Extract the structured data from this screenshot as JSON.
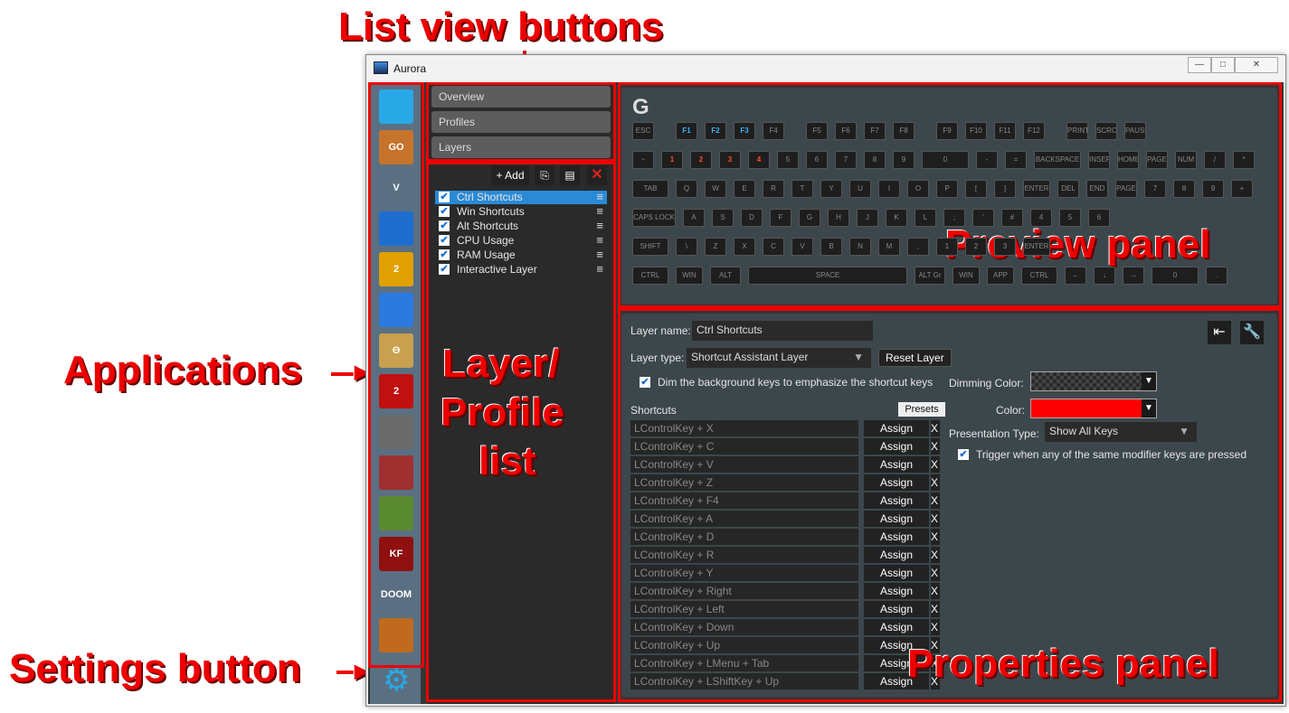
{
  "annotations": {
    "list_view_buttons": "List view buttons",
    "applications": "Applications",
    "layer_profile_list_1": "Layer/",
    "layer_profile_list_2": "Profile",
    "layer_profile_list_3": "list",
    "preview_panel": "Preview panel",
    "settings_button": "Settings button",
    "properties_panel": "Properties panel"
  },
  "window": {
    "title": "Aurora",
    "minimize": "—",
    "maximize": "□",
    "close": "✕"
  },
  "apps": [
    {
      "name": "desktop",
      "label": "",
      "color": "#29a8e6"
    },
    {
      "name": "csgo",
      "label": "GO",
      "color": "#c6742c"
    },
    {
      "name": "gta-v",
      "label": "V",
      "color": "#5a7082"
    },
    {
      "name": "rocket-league",
      "label": "",
      "color": "#1e6ed0"
    },
    {
      "name": "payday-2",
      "label": "2",
      "color": "#e0a000"
    },
    {
      "name": "dota-2",
      "label": "",
      "color": "#2a7ae0"
    },
    {
      "name": "overwatch-style",
      "label": "Θ",
      "color": "#c8a050"
    },
    {
      "name": "guild-wars-2",
      "label": "2",
      "color": "#c01010"
    },
    {
      "name": "euro-truck",
      "label": "",
      "color": "#6a6a6a"
    },
    {
      "name": "american-truck",
      "label": "",
      "color": "#a03030"
    },
    {
      "name": "minecraft",
      "label": "",
      "color": "#5a8a30"
    },
    {
      "name": "killing-floor-2",
      "label": "KF",
      "color": "#901010"
    },
    {
      "name": "doom",
      "label": "DOOM",
      "color": "#5a7082"
    },
    {
      "name": "generic-app",
      "label": "",
      "color": "#c06a20"
    }
  ],
  "settings_icon": "gear-icon",
  "view_buttons": [
    "Overview",
    "Profiles",
    "Layers"
  ],
  "list_toolbar": {
    "add": "+ Add"
  },
  "layers": [
    {
      "label": "Ctrl Shortcuts",
      "selected": true
    },
    {
      "label": "Win Shortcuts",
      "selected": false
    },
    {
      "label": "Alt Shortcuts",
      "selected": false
    },
    {
      "label": "CPU Usage",
      "selected": false
    },
    {
      "label": "RAM Usage",
      "selected": false
    },
    {
      "label": "Interactive Layer",
      "selected": false
    }
  ],
  "keyboard": {
    "brand_logo": "G",
    "rows": [
      [
        "ESC",
        "F1",
        "F2",
        "F3",
        "F4",
        "F5",
        "F6",
        "F7",
        "F8",
        "F9",
        "F10",
        "F11",
        "F12",
        "PRINT",
        "SCROLL LOCK",
        "PAUSE"
      ],
      [
        "~",
        "1",
        "2",
        "3",
        "4",
        "5",
        "6",
        "7",
        "8",
        "9",
        "0",
        "-",
        "=",
        "BACKSPACE",
        "INSERT",
        "HOME",
        "PAGE UP",
        "NUM LOCK",
        "/",
        "*",
        "-"
      ],
      [
        "TAB",
        "Q",
        "W",
        "E",
        "R",
        "T",
        "Y",
        "U",
        "I",
        "O",
        "P",
        "[",
        "]",
        "ENTER",
        "DEL",
        "END",
        "PAGE DOWN",
        "7",
        "8",
        "9",
        "+"
      ],
      [
        "CAPS LOCK",
        "A",
        "S",
        "D",
        "F",
        "G",
        "H",
        "J",
        "K",
        "L",
        ";",
        "'",
        "#",
        "4",
        "5",
        "6"
      ],
      [
        "SHIFT",
        "\\",
        "Z",
        "X",
        "C",
        "V",
        "B",
        "N",
        "M",
        ",",
        "1",
        "2",
        "3",
        "ENTER"
      ],
      [
        "CTRL",
        "WIN",
        "ALT",
        "SPACE",
        "ALT Gr",
        "WIN",
        "APP",
        "CTRL",
        "←",
        "↓",
        "→",
        "0",
        "."
      ]
    ]
  },
  "properties": {
    "layer_name_label": "Layer name:",
    "layer_name_value": "Ctrl Shortcuts",
    "layer_type_label": "Layer type:",
    "layer_type_value": "Shortcut Assistant Layer",
    "reset_layer": "Reset Layer",
    "dim_label": "Dim the background keys to emphasize the shortcut keys",
    "shortcuts_label": "Shortcuts",
    "presets": "Presets",
    "dimming_color_label": "Dimming Color:",
    "color_label": "Color:",
    "color_value": "#ff0000",
    "presentation_type_label": "Presentation Type:",
    "presentation_type_value": "Show All Keys",
    "trigger_label": "Trigger when any of the same modifier keys are pressed",
    "assign": "Assign",
    "remove": "X",
    "shortcuts": [
      "LControlKey + X",
      "LControlKey + C",
      "LControlKey + V",
      "LControlKey + Z",
      "LControlKey + F4",
      "LControlKey + A",
      "LControlKey + D",
      "LControlKey + R",
      "LControlKey + Y",
      "LControlKey + Right",
      "LControlKey + Left",
      "LControlKey + Down",
      "LControlKey + Up",
      "LControlKey + LMenu + Tab",
      "LControlKey + LShiftKey + Up"
    ]
  }
}
